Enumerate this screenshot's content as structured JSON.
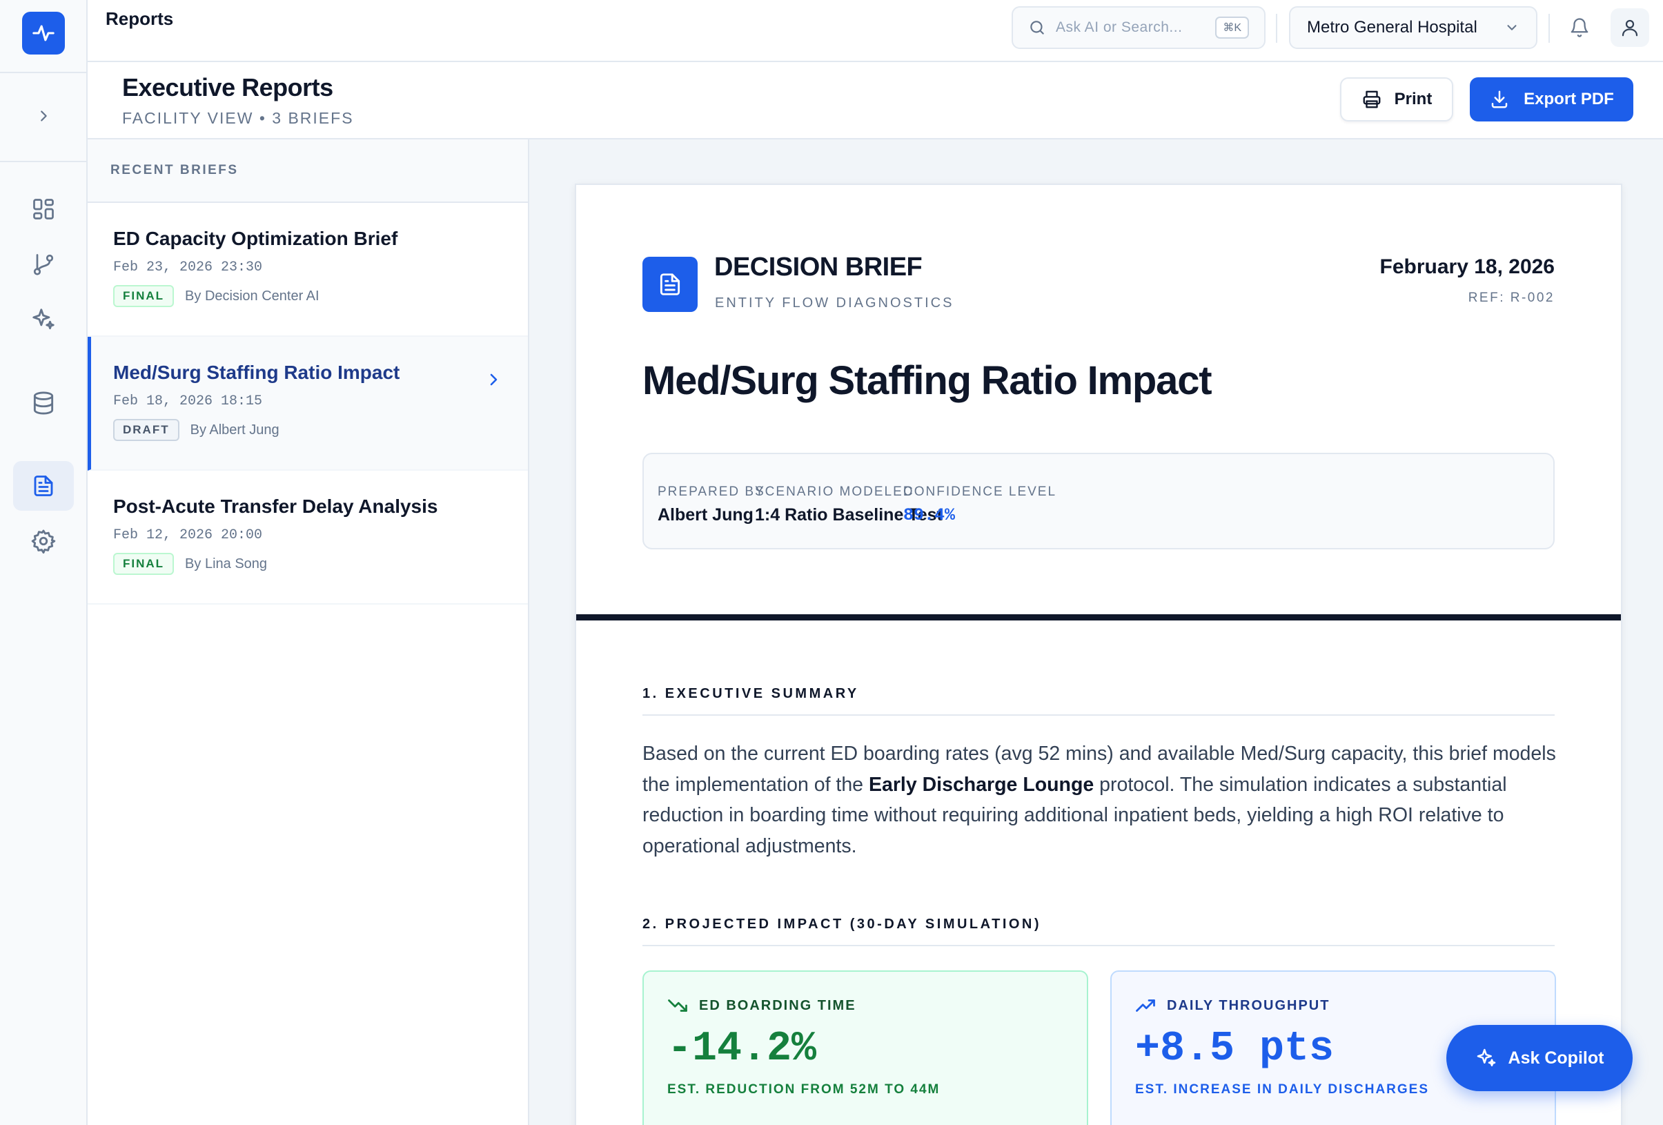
{
  "app": {
    "breadcrumb": "Reports"
  },
  "topbar": {
    "search_placeholder": "Ask AI or Search...",
    "search_shortcut": "⌘K",
    "facility": "Metro General Hospital"
  },
  "header": {
    "title": "Executive Reports",
    "subtitle": "FACILITY VIEW • 3 BRIEFS",
    "print_label": "Print",
    "export_label": "Export PDF"
  },
  "briefs": {
    "heading": "RECENT BRIEFS",
    "items": [
      {
        "name": "ED Capacity Optimization Brief",
        "date": "Feb 23, 2026 23:30",
        "status": "FINAL",
        "author": "By Decision Center AI"
      },
      {
        "name": "Med/Surg Staffing Ratio Impact",
        "date": "Feb 18, 2026 18:15",
        "status": "DRAFT",
        "author": "By Albert Jung"
      },
      {
        "name": "Post-Acute Transfer Delay Analysis",
        "date": "Feb 12, 2026 20:00",
        "status": "FINAL",
        "author": "By Lina Song"
      }
    ]
  },
  "document": {
    "kind": "DECISION BRIEF",
    "section": "ENTITY FLOW DIAGNOSTICS",
    "date": "February 18, 2026",
    "ref": "REF: R-002",
    "title": "Med/Surg Staffing Ratio Impact",
    "info": {
      "prepared_by_label": "PREPARED BY",
      "prepared_by": "Albert Jung",
      "scenario_label": "SCENARIO MODELED",
      "scenario": "1:4 Ratio Baseline Test",
      "confidence_label": "CONFIDENCE LEVEL",
      "confidence": "89.4%"
    },
    "summary_heading": "1. EXECUTIVE SUMMARY",
    "summary_before": "Based on the current ED boarding rates (avg 52 mins) and available Med/Surg capacity, this brief models the implementation of the ",
    "summary_bold": "Early Discharge Lounge",
    "summary_after": " protocol. The simulation indicates a substantial reduction in boarding time without requiring additional inpatient beds, yielding a high ROI relative to operational adjustments.",
    "impact_heading": "2. PROJECTED IMPACT (30-DAY SIMULATION)",
    "metrics": [
      {
        "label": "ED BOARDING TIME",
        "value": "-14.2%",
        "desc": "EST. REDUCTION FROM 52M TO 44M"
      },
      {
        "label": "DAILY THROUGHPUT",
        "value": "+8.5 pts",
        "desc": "EST. INCREASE IN DAILY DISCHARGES"
      }
    ]
  },
  "copilot": {
    "label": "Ask Copilot"
  },
  "colors": {
    "primary": "#1d5eea",
    "success": "#15803d",
    "text": "#0f172a",
    "muted": "#64748b"
  },
  "icons": [
    "activity-icon",
    "chevron-right-icon",
    "dashboard-icon",
    "git-branch-icon",
    "sparkles-icon",
    "database-icon",
    "document-icon",
    "gear-icon",
    "search-icon",
    "chevron-down-icon",
    "bell-icon",
    "user-icon",
    "printer-icon",
    "download-icon",
    "trending-down-icon",
    "trending-up-icon"
  ]
}
